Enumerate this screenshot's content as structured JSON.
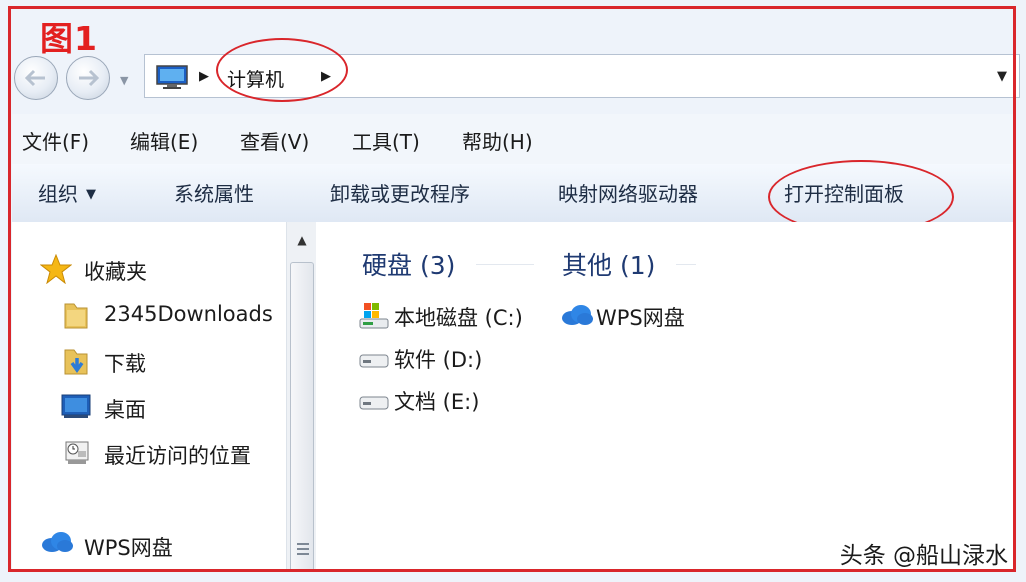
{
  "figure_label": "图1",
  "address_bar": {
    "path_segment": "计算机"
  },
  "menu": [
    "文件(F)",
    "编辑(E)",
    "查看(V)",
    "工具(T)",
    "帮助(H)"
  ],
  "toolbar": {
    "organize": "组织",
    "system_properties": "系统属性",
    "uninstall": "卸载或更改程序",
    "map_drive": "映射网络驱动器",
    "open_control_panel": "打开控制面板"
  },
  "nav_pane": {
    "favorites": "收藏夹",
    "items": [
      "2345Downloads",
      "下载",
      "桌面",
      "最近访问的位置"
    ],
    "wps": "WPS网盘"
  },
  "content": {
    "hard_disks_header": "硬盘 (3)",
    "other_header": "其他 (1)",
    "drives": [
      "本地磁盘 (C:)",
      "软件 (D:)",
      "文档 (E:)"
    ],
    "other_items": [
      "WPS网盘"
    ]
  },
  "watermark": "头条 @船山渌水",
  "colors": {
    "annotation_red": "#d9262b",
    "group_header": "#1f3a72"
  }
}
